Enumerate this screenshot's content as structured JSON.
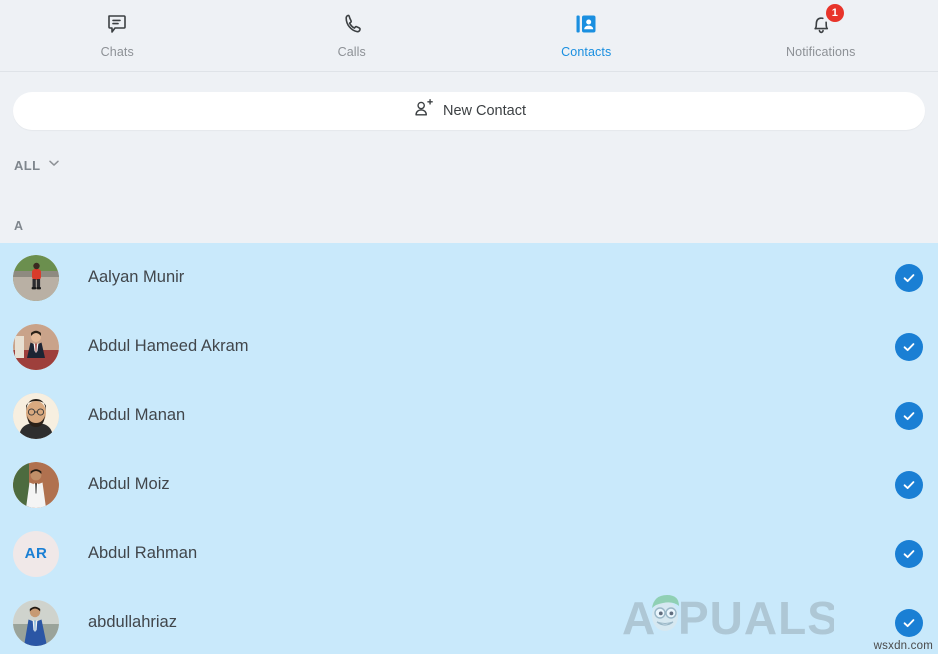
{
  "colors": {
    "background": "#eef1f5",
    "accent": "#1a7fd4",
    "active_tab": "#1a8fe0",
    "row_selected": "#c9e9fb",
    "badge_red": "#e8342a",
    "muted_text": "#8d9196",
    "name_text": "#41464b"
  },
  "topnav": {
    "tabs": [
      {
        "label": "Chats",
        "icon": "chat-bubble-icon",
        "active": false,
        "badge": null
      },
      {
        "label": "Calls",
        "icon": "phone-handset-icon",
        "active": false,
        "badge": null
      },
      {
        "label": "Contacts",
        "icon": "contact-card-icon",
        "active": true,
        "badge": null
      },
      {
        "label": "Notifications",
        "icon": "bell-icon",
        "active": false,
        "badge": "1"
      }
    ]
  },
  "new_contact": {
    "label": "New Contact",
    "icon": "person-plus-icon"
  },
  "filter": {
    "label": "ALL",
    "icon": "chevron-down-icon"
  },
  "section": {
    "letter": "A"
  },
  "contacts": [
    {
      "name": "Aalyan Munir",
      "avatar_type": "photo",
      "initials": "",
      "selected": true
    },
    {
      "name": "Abdul Hameed Akram",
      "avatar_type": "photo",
      "initials": "",
      "selected": true
    },
    {
      "name": "Abdul Manan",
      "avatar_type": "photo",
      "initials": "",
      "selected": true
    },
    {
      "name": "Abdul Moiz",
      "avatar_type": "photo",
      "initials": "",
      "selected": true
    },
    {
      "name": "Abdul Rahman",
      "avatar_type": "initials",
      "initials": "AR",
      "selected": true
    },
    {
      "name": "abdullahriaz",
      "avatar_type": "photo",
      "initials": "",
      "selected": true
    }
  ],
  "watermark": {
    "brand": "APPUALS",
    "site": "wsxdn.com"
  }
}
